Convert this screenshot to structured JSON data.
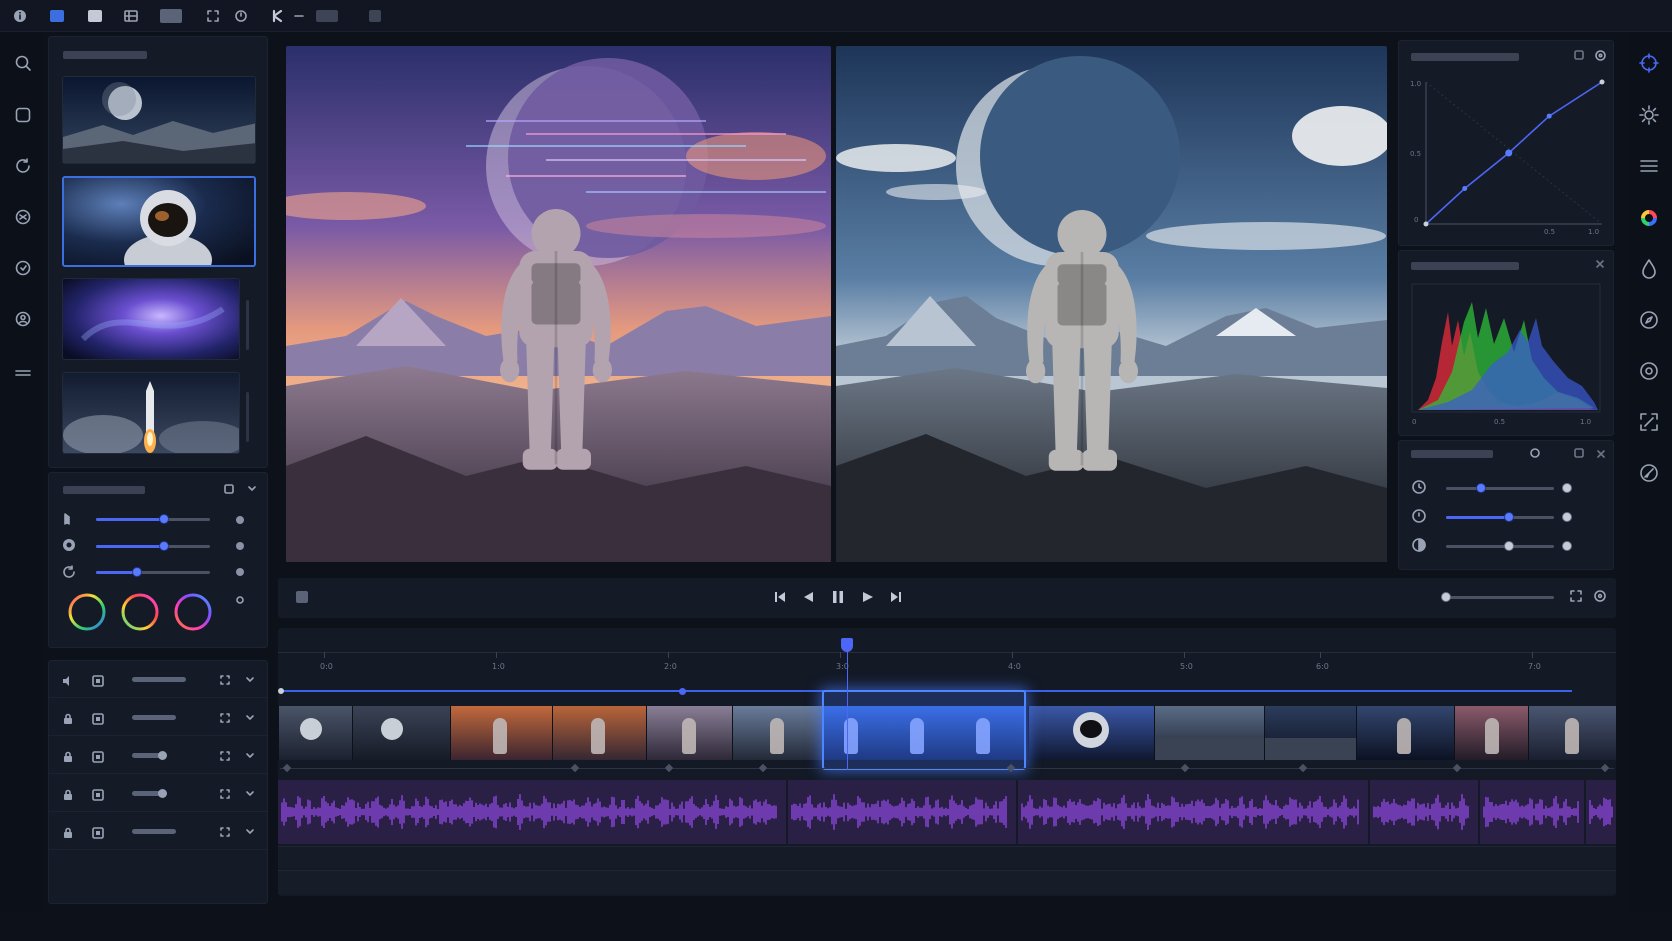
{
  "colors": {
    "accent": "#4c67f5",
    "selection": "#3b6fe0",
    "audio": "#8c48dc",
    "panel": "#141a26",
    "background": "#0d1119"
  },
  "toolbar": {
    "icons": [
      "info-icon",
      "video-icon",
      "film-icon",
      "grid-icon",
      "monitor-icon",
      "crop-icon",
      "timer-icon",
      "cut-tool-icon",
      "layout-icon",
      "snapshot-icon"
    ]
  },
  "left_rail": {
    "icons": [
      "search-icon",
      "media-icon",
      "loop-icon",
      "effects-icon",
      "transition-icon",
      "people-icon",
      "menu-icon"
    ]
  },
  "right_rail": {
    "icons": [
      "color-wheel-icon",
      "brightness-icon",
      "list-icon",
      "color-palette-icon",
      "droplet-icon",
      "compass-icon",
      "target-icon",
      "transform-icon",
      "speed-icon"
    ]
  },
  "media_bin": {
    "clips": [
      "planet-landscape",
      "astronaut-portrait",
      "nebula",
      "rocket-launch"
    ],
    "selected_index": 1
  },
  "adjust_panel": {
    "sliders": [
      {
        "icon": "exposure-icon",
        "value": 0.6
      },
      {
        "icon": "saturation-icon",
        "value": 0.6
      },
      {
        "icon": "tint-icon",
        "value": 0.36
      }
    ],
    "color_wheels": [
      "shadows",
      "midtones",
      "highlights"
    ]
  },
  "curves": {
    "y_ticks": [
      "1.0",
      "0.5",
      "0"
    ],
    "x_ticks": [
      "0.5",
      "1.0"
    ],
    "points": [
      [
        0,
        0
      ],
      [
        0.22,
        0.25
      ],
      [
        0.47,
        0.5
      ],
      [
        0.7,
        0.76
      ],
      [
        1,
        1
      ]
    ]
  },
  "histogram": {
    "x_ticks": [
      "0",
      "0.5",
      "1.0"
    ]
  },
  "color_controls": {
    "sliders": [
      {
        "icon": "clock-icon",
        "value": 0.32
      },
      {
        "icon": "timer-icon",
        "value": 0.58
      },
      {
        "icon": "contrast-icon",
        "value": 0.58
      }
    ]
  },
  "transport": {
    "zoom": 0.0
  },
  "timeline": {
    "ticks": [
      "0:0",
      "1:0",
      "2:0",
      "3:0",
      "4:0",
      "5:0",
      "6:0",
      "7:0"
    ],
    "playhead": 0.425,
    "in_marker": 0.3,
    "tracks": [
      {
        "icon": "speaker-icon",
        "locked": false
      },
      {
        "icon": "lock-icon",
        "locked": true
      },
      {
        "icon": "lock-icon",
        "locked": true
      },
      {
        "icon": "lock-icon",
        "locked": true
      },
      {
        "icon": "lock-icon",
        "locked": true
      }
    ]
  }
}
